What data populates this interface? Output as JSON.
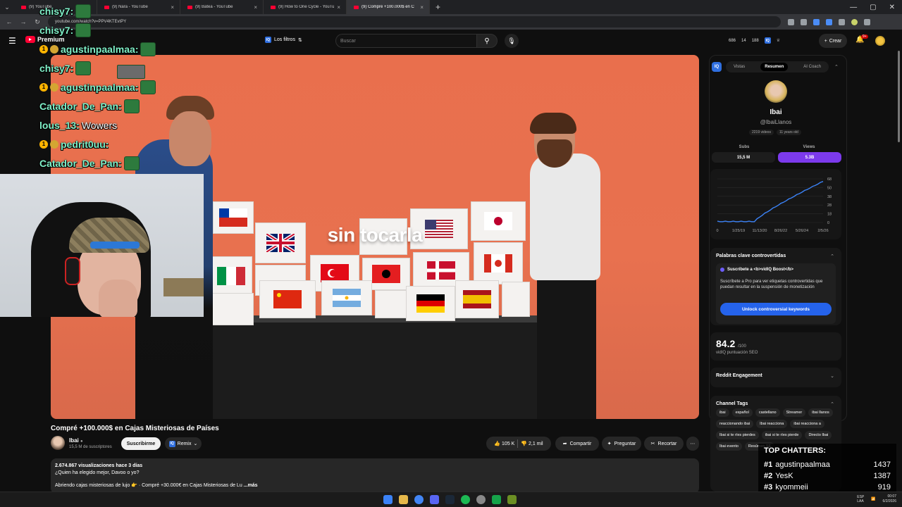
{
  "browser": {
    "tabs": [
      {
        "title": "(9) YouTube",
        "active": false
      },
      {
        "title": "(9) Nara - YouTube",
        "active": false
      },
      {
        "title": "(9) Batea - YouTube",
        "active": false
      },
      {
        "title": "(9) How to One Cycle - YouTube",
        "active": false
      },
      {
        "title": "(9) Compré +100.000$ en C",
        "active": true
      }
    ],
    "url": "youtube.com/watch?v=PPV4KTEvtPY"
  },
  "yt_header": {
    "logo_text": "Premium",
    "filters_label": "Los filtros",
    "search_placeholder": "Buscar",
    "stats": [
      "686",
      "14",
      "188"
    ],
    "create_label": "Crear",
    "notif_badge": "9+"
  },
  "video": {
    "caption": "sin tocarla",
    "title": "Compré +100.000$ en Cajas Misteriosas de Países"
  },
  "chat": [
    {
      "user": "chisy7:",
      "msg": "",
      "badge": "",
      "emote": "green"
    },
    {
      "user": "chisy7:",
      "msg": "",
      "badge": "",
      "emote": "green"
    },
    {
      "user": "agustinpaalmaa:",
      "msg": "",
      "badge": "1",
      "emote": "green"
    },
    {
      "user": "chisy7:",
      "msg": "",
      "badge": "",
      "emote": "green"
    },
    {
      "user": "agustinpaalmaa:",
      "msg": "",
      "badge": "1",
      "emote": "green"
    },
    {
      "user": "Catador_De_Pan:",
      "msg": "",
      "badge": "",
      "emote": "green"
    },
    {
      "user": "lous_13:",
      "msg": "Wowers",
      "badge": "",
      "emote": ""
    },
    {
      "user": "pedrit0uu:",
      "msg": "",
      "badge": "1",
      "emote": "face"
    },
    {
      "user": "Catador_De_Pan:",
      "msg": "",
      "badge": "",
      "emote": "green"
    }
  ],
  "channel": {
    "name": "Ibai",
    "subs": "15,5 M de suscriptores",
    "subscribe_label": "Suscribirme",
    "remix_label": "Remix"
  },
  "actions": {
    "likes": "105 K",
    "dislikes": "2,1 mil",
    "share": "Compartir",
    "ask": "Preguntar",
    "clip": "Recortar"
  },
  "description": {
    "views_line": "2.674.867 visualizaciones  hace 3 días",
    "line2": "¿Quien ha elegido mejor, Davoo o yo?",
    "line3": "Abriendo cajas misteriosas de lujo 👉 · Compré +30.000€ en Cajas Misteriosas de Lu",
    "more": "...más"
  },
  "vidiq": {
    "tabs": [
      "Vistas",
      "Resumen",
      "AI Coach"
    ],
    "active_tab": "Resumen",
    "name": "Ibai",
    "handle": "@IbaiLlanos",
    "pills": [
      "2219 videos",
      "11 years old"
    ],
    "subs_label": "Subs",
    "views_label": "Views",
    "subs_value": "15,5 M",
    "views_value": "5.3B",
    "chart_x_labels": [
      "0",
      "1/25/19",
      "11/13/20",
      "8/26/22",
      "5/26/24",
      "2/5/26"
    ],
    "chart_y_labels": [
      "68",
      "50",
      "38",
      "28",
      "18",
      "0"
    ],
    "keywords_title": "Palabras clave controvertidas",
    "upsell_title": "Suscríbete a <b>vidIQ Boost</b>",
    "upsell_body": "Suscríbete a Pro para ver etiquetas controvertidas que puedan resultar en la suspensión de monetización",
    "upsell_button": "Unlock controversial keywords",
    "seo_score": "84.2",
    "seo_max": "/100",
    "seo_label": "vidIQ puntuación SEO",
    "reddit_title": "Reddit Engagement",
    "tags_title": "Channel Tags",
    "tags": [
      "ibai",
      "español",
      "castellano",
      "Streamer",
      "ibai llanos",
      "reaccionando ibai",
      "Ibai reacciona",
      "ibai reacciona a",
      "Ibai si te ríes pierdes",
      "ibai si te ríes pierde",
      "Directo Ibai",
      "Ibai evento",
      "Resúmen SE"
    ]
  },
  "top_chatters": {
    "title": "TOP CHATTERS:",
    "rows": [
      {
        "rank": "#1",
        "name": "agustinpaalmaa",
        "count": "1437"
      },
      {
        "rank": "#2",
        "name": "YesK",
        "count": "1387"
      },
      {
        "rank": "#3",
        "name": "kyommeii",
        "count": "919"
      }
    ]
  },
  "taskbar": {
    "lang": "ESP\nLAA",
    "time": "00:07",
    "date": "6/2/2026"
  }
}
